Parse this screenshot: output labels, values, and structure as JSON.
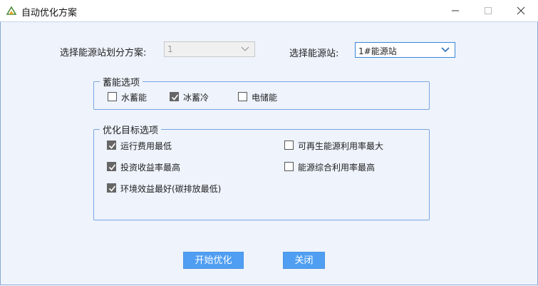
{
  "window": {
    "title": "自动优化方案",
    "icon": "app-logo-icon"
  },
  "form": {
    "scheme_label": "选择能源站划分方案:",
    "scheme_value": "1",
    "station_label": "选择能源站:",
    "station_value": "1#能源站"
  },
  "storage_group": {
    "title": "蓄能选项",
    "options": [
      {
        "label": "水蓄能",
        "checked": false
      },
      {
        "label": "冰蓄冷",
        "checked": true
      },
      {
        "label": "电储能",
        "checked": false
      }
    ]
  },
  "goals_group": {
    "title": "优化目标选项",
    "options": [
      {
        "label": "运行费用最低",
        "checked": true
      },
      {
        "label": "可再生能源利用率最大",
        "checked": false
      },
      {
        "label": "投资收益率最高",
        "checked": true
      },
      {
        "label": "能源综合利用率最高",
        "checked": false
      },
      {
        "label": "环境效益最好(碳排放最低)",
        "checked": true
      }
    ]
  },
  "buttons": {
    "start": "开始优化",
    "close": "关闭"
  },
  "colors": {
    "accent": "#4f9ef2",
    "panel_bg": "#eef3fc",
    "group_border": "#7aa6e0"
  }
}
